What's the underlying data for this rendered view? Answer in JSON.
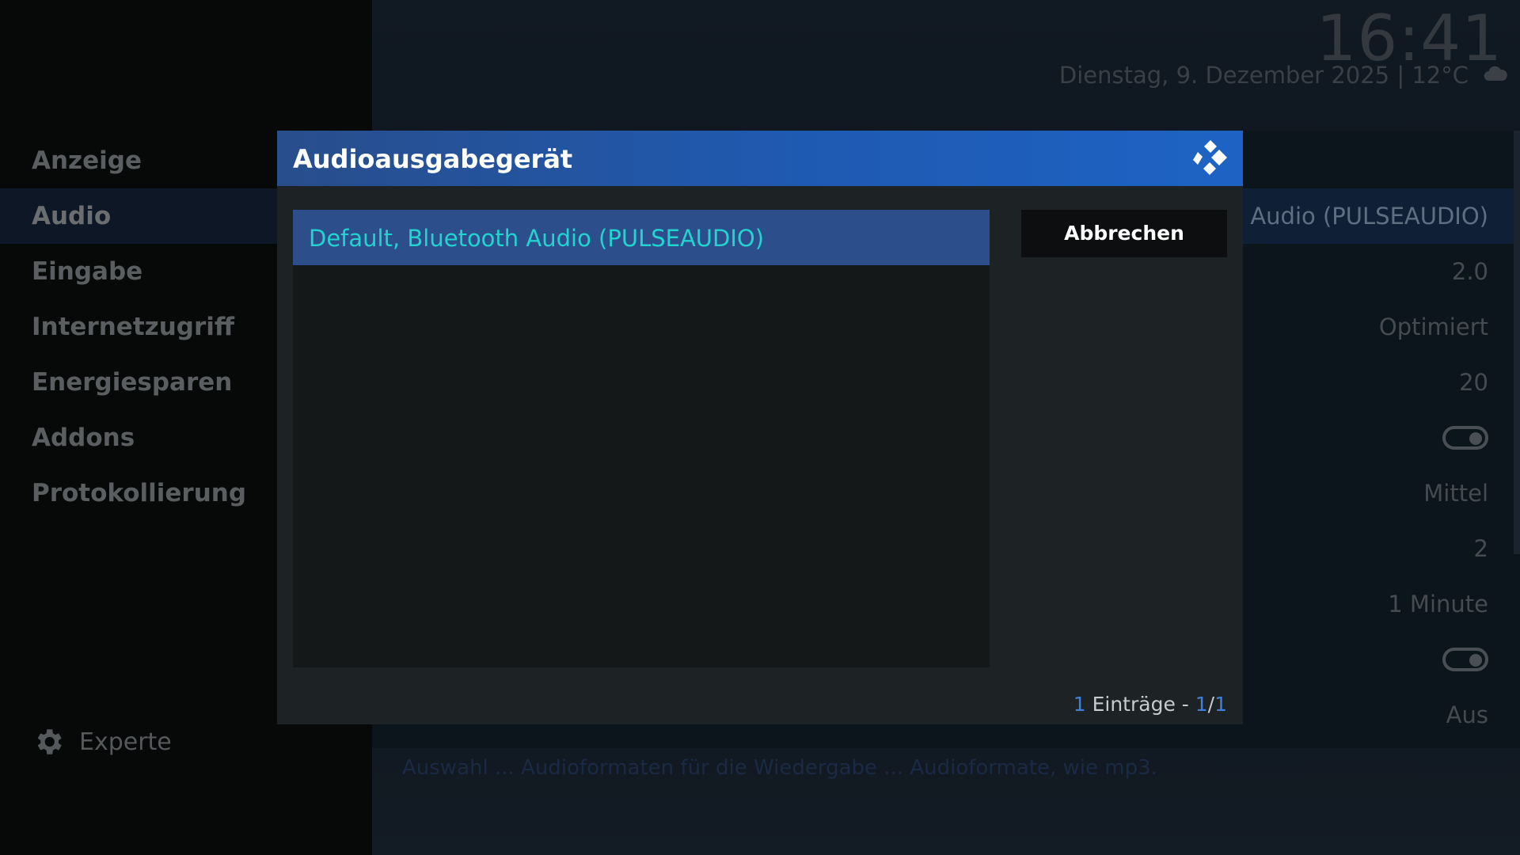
{
  "sidebar": {
    "items": [
      {
        "label": "Anzeige"
      },
      {
        "label": "Audio"
      },
      {
        "label": "Eingabe"
      },
      {
        "label": "Internetzugriff"
      },
      {
        "label": "Energiesparen"
      },
      {
        "label": "Addons"
      },
      {
        "label": "Protokollierung"
      }
    ],
    "active_index": 1,
    "experte_label": "Experte"
  },
  "clock": {
    "time": "16:41",
    "date": "Dienstag, 9. Dezember 2025 | 12°C",
    "weather_icon": "cloud-icon"
  },
  "background_settings": {
    "values": [
      "th Audio (PULSEAUDIO)",
      "2.0",
      "Optimiert",
      "20",
      "Mittel",
      "2",
      "1 Minute",
      "Aus"
    ],
    "toggles_on": [
      true,
      true
    ],
    "description": "Auswahl ... Audioformaten für die Wiedergabe ... Audioformate, wie mp3."
  },
  "dialog": {
    "title": "Audioausgabegerät",
    "logo": "kodi-logo-icon",
    "items": [
      {
        "label": "Default, Bluetooth Audio (PULSEAUDIO)"
      }
    ],
    "cancel_label": "Abbrechen",
    "counter": {
      "count": "1",
      "entries_text": " Einträge - ",
      "page": "1",
      "separator": "/",
      "pages": "1"
    }
  },
  "colors": {
    "accent": "#1f5ab2",
    "selected_item_text": "#22d3d0",
    "counter_highlight": "#3f7fe0"
  }
}
